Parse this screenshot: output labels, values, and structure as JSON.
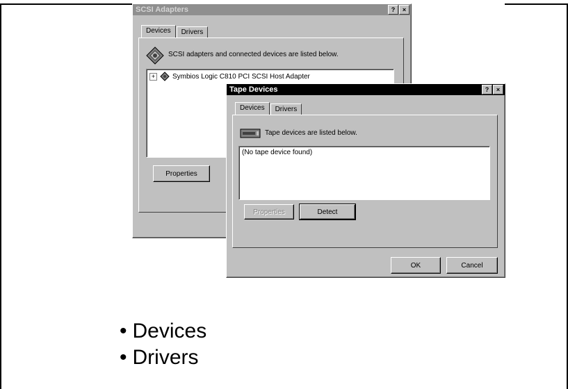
{
  "scsi_window": {
    "title": "SCSI Adapters",
    "help_glyph": "?",
    "close_glyph": "×",
    "tabs": [
      "Devices",
      "Drivers"
    ],
    "description": "SCSI adapters and connected devices are listed below.",
    "tree_item": "Symbios Logic C810 PCI SCSI Host Adapter",
    "tree_expander": "+",
    "properties_button": "Properties"
  },
  "tape_window": {
    "title": "Tape Devices",
    "help_glyph": "?",
    "close_glyph": "×",
    "tabs": [
      "Devices",
      "Drivers"
    ],
    "description": "Tape devices are listed below.",
    "list_item": "(No tape device found)",
    "properties_button": "Properties",
    "detect_button": "Detect",
    "ok_button": "OK",
    "cancel_button": "Cancel"
  },
  "bullets": [
    "Devices",
    "Drivers"
  ],
  "bullet_glyph": "•",
  "icons": {
    "scsi_adapter_icon": "diamond-adapter",
    "tape_drive_icon": "tape-drive"
  }
}
